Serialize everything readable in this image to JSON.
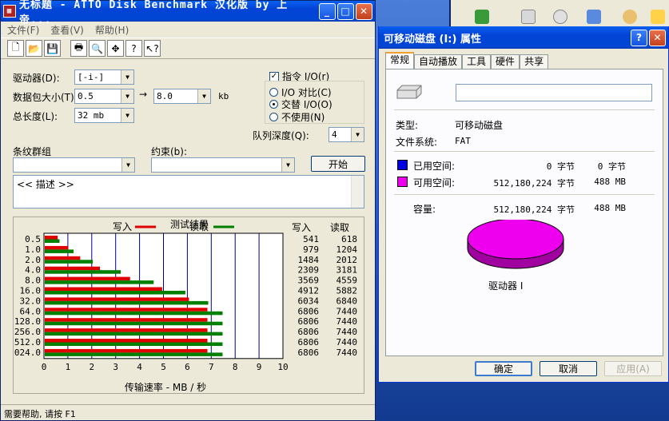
{
  "atto": {
    "title": "无标题 - ATTO Disk Benchmark  汉化版 by 上帝...",
    "menu": [
      "文件(F)",
      "查看(V)",
      "帮助(H)"
    ],
    "drive_label": "驱动器(D):",
    "drive_value": "[-i-]",
    "transfer_label": "数据包大小(T):",
    "transfer_from": "0.5",
    "transfer_to": "8.0",
    "transfer_unit": "kb",
    "length_label": "总长度(L):",
    "length_value": "32 mb",
    "direct_io": "指令 I/O(r)",
    "io_compare": "I/O 对比(C)",
    "overlapped": "交替 I/O(O)",
    "neither": "不使用(N)",
    "queue_label": "队列深度(Q):",
    "queue_value": "4",
    "stripe_label": "条纹群组",
    "restrict_label": "约束(b):",
    "start_button": "开始",
    "description": "<< 描述 >>",
    "results_title": "测试结果",
    "write_legend": "写入",
    "read_legend": "读取",
    "col_write": "写入",
    "col_read": "读取",
    "xlabel": "传输速率 - MB / 秒",
    "status_text": "需要帮助, 请按 F1"
  },
  "chart_data": {
    "type": "bar",
    "categories": [
      "0.5",
      "1.0",
      "2.0",
      "4.0",
      "8.0",
      "16.0",
      "32.0",
      "64.0",
      "128.0",
      "256.0",
      "512.0",
      "024.0"
    ],
    "series": [
      {
        "name": "写入",
        "color": "#e00000",
        "values": [
          541,
          979,
          1484,
          2309,
          3569,
          4912,
          6034,
          6806,
          6806,
          6806,
          6806,
          6806
        ]
      },
      {
        "name": "读取",
        "color": "#008000",
        "values": [
          618,
          1204,
          2012,
          3181,
          4559,
          5882,
          6840,
          7440,
          7440,
          7440,
          7440,
          7440
        ]
      }
    ],
    "xticks": [
      "0",
      "1",
      "2",
      "3",
      "4",
      "5",
      "6",
      "7",
      "8",
      "9",
      "10"
    ],
    "xlim": [
      0,
      10
    ],
    "xlabel": "传输速率 - MB / 秒",
    "title": "测试结果"
  },
  "dialog": {
    "title": "可移动磁盘 (I:) 属性",
    "tabs": [
      "常规",
      "自动播放",
      "工具",
      "硬件",
      "共享"
    ],
    "type_label": "类型:",
    "type_value": "可移动磁盘",
    "fs_label": "文件系统:",
    "fs_value": "FAT",
    "used_label": "已用空间:",
    "used_bytes": "0 字节",
    "used_size": "0 字节",
    "free_label": "可用空间:",
    "free_bytes": "512,180,224 字节",
    "free_size": "488 MB",
    "cap_label": "容量:",
    "cap_bytes": "512,180,224 字节",
    "cap_size": "488 MB",
    "drive_caption": "驱动器 I",
    "ok": "确定",
    "cancel": "取消",
    "apply": "应用(A)",
    "used_color": "#0000e0",
    "free_color": "#ee00ee"
  }
}
